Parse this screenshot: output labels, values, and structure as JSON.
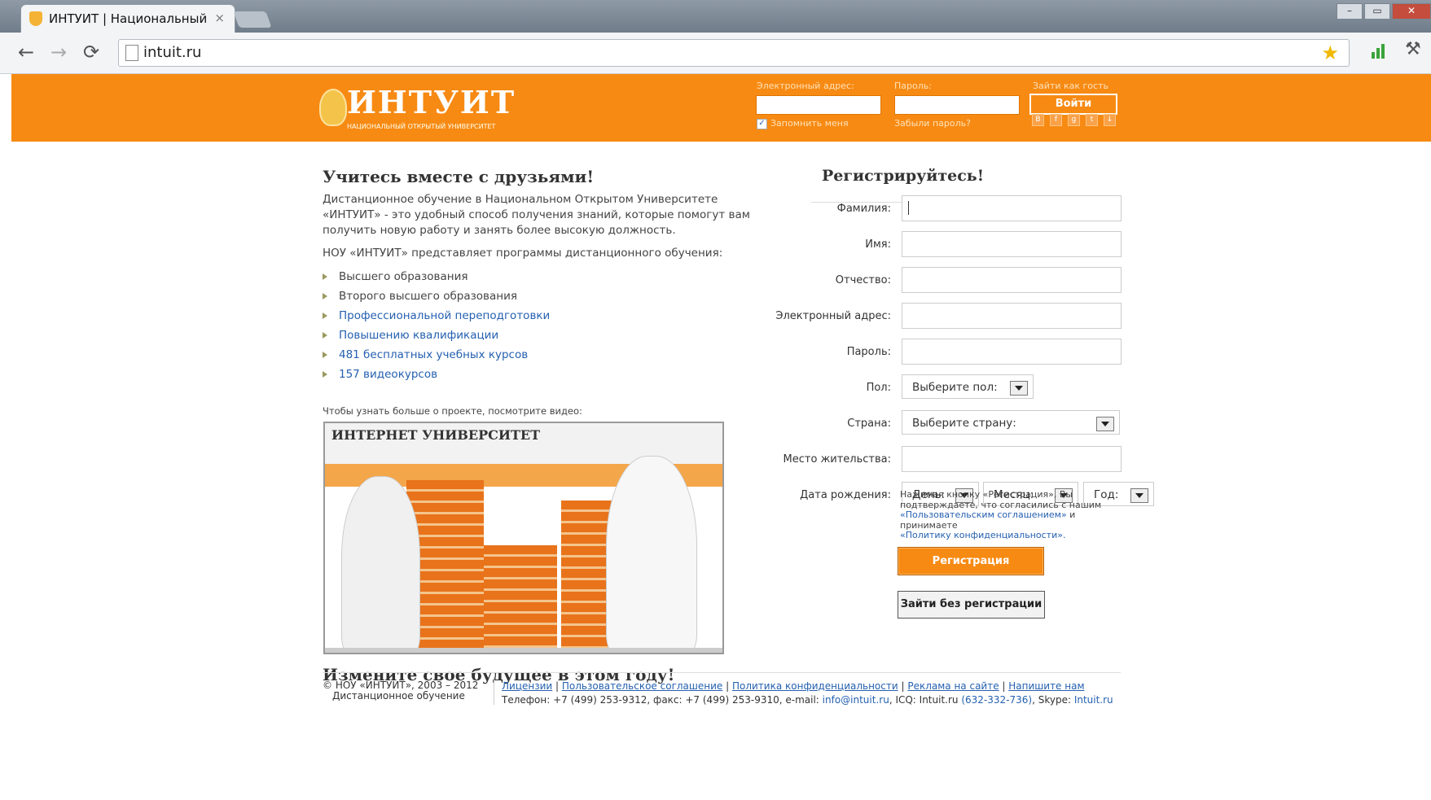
{
  "browser": {
    "tab_title": "ИНТУИТ | Национальный",
    "tab_close": "×",
    "url": "intuit.ru",
    "back_icon": "←",
    "forward_icon": "→",
    "reload_icon": "⟳",
    "star_icon": "★",
    "wrench_icon": "🔧"
  },
  "header": {
    "logo_text": "ИНТУИТ",
    "logo_subtext": "НАЦИОНАЛЬНЫЙ ОТКРЫТЫЙ УНИВЕРСИТЕТ",
    "email_label": "Электронный адрес:",
    "password_label": "Пароль:",
    "guest_label": "Зайти как гость",
    "remember_label": "Запомнить меня",
    "forgot_label": "Забыли пароль?",
    "login_button": "Войти",
    "social": [
      "В",
      "f",
      "g",
      "t",
      "↓"
    ]
  },
  "left": {
    "heading": "Учитесь вместе с друзьями!",
    "intro": [
      "Дистанционное обучение в Национальном Открытом Университете",
      "«ИНТУИТ» - это удобный способ получения знаний, которые помогут вам",
      "получить новую работу и занять более высокую должность."
    ],
    "programs_intro": "НОУ «ИНТУИТ» представляет программы дистанционного обучения:",
    "programs": [
      {
        "label": "Высшего образования",
        "link": false
      },
      {
        "label": "Второго высшего образования",
        "link": false
      },
      {
        "label": "Профессиональной переподготовки",
        "link": true
      },
      {
        "label": "Повышению квалификации",
        "link": true
      },
      {
        "label": "481 бесплатных учебных курсов",
        "link": true
      },
      {
        "label": "157 видеокурсов",
        "link": true
      }
    ],
    "video_caption": "Чтобы узнать больше о проекте, посмотрите видео:",
    "video_brand": "ИНТЕРНЕТ УНИВЕРСИТЕТ",
    "bottom_heading": "Измените свое будущее в этом году!"
  },
  "form": {
    "heading": "Регистрируйтесь!",
    "fields": {
      "last_name": "Фамилия:",
      "first_name": "Имя:",
      "middle_name": "Отчество:",
      "email": "Электронный адрес:",
      "password": "Пароль:",
      "gender": "Пол:",
      "country": "Страна:",
      "residence": "Место жительства:",
      "birthdate": "Дата рождения:"
    },
    "gender_value": "Выберите пол:",
    "country_value": "Выберите страну:",
    "day_value": "День:",
    "month_value": "Месяц:",
    "year_value": "Год:",
    "agree_1": "Нажимая кнопку «Регистрация», Вы подтверждаете, что согласились с нашим",
    "agree_link1": "«Пользовательским соглашением»",
    "agree_2": " и принимаете",
    "agree_link2": "«Политику конфиденциальности».",
    "register_button": "Регистрация",
    "guest_button": "Зайти без регистрации"
  },
  "footer": {
    "copyright": "© НОУ «ИНТУИТ», 2003 – 2012",
    "copyright_sub": "Дистанционное обучение",
    "links": [
      "Лицензии",
      "Пользовательское соглашение",
      "Политика конфиденциальности",
      "Реклама на сайте",
      "Напишите нам"
    ],
    "contact_prefix": "Телефон: +7 (499) 253-9312, факс: +7 (499) 253-9310, e-mail: ",
    "email": "info@intuit.ru",
    "icq_prefix": ", ICQ: Intuit.ru ",
    "icq": "(632-332-736)",
    "skype_prefix": ", Skype: ",
    "skype": "Intuit.ru"
  }
}
